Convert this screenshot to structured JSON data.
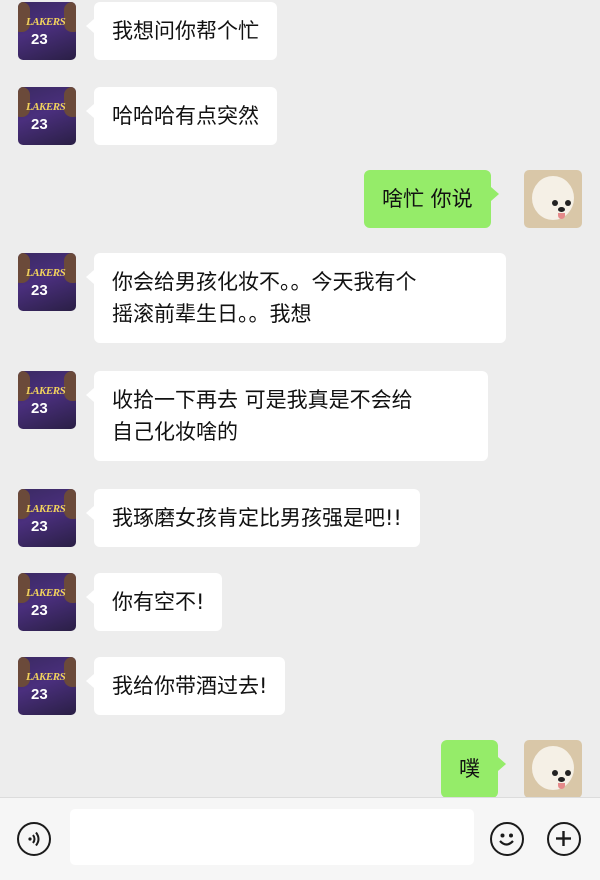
{
  "messages": [
    {
      "side": "left",
      "avatar": "lakers-23-avatar",
      "lines": [
        "我想问你帮个忙"
      ]
    },
    {
      "side": "left",
      "avatar": "lakers-23-avatar",
      "lines": [
        "哈哈哈有点突然"
      ]
    },
    {
      "side": "right",
      "avatar": "white-dog-avatar",
      "lines": [
        "啥忙 你说"
      ]
    },
    {
      "side": "left",
      "avatar": "lakers-23-avatar",
      "lines": [
        "你会给男孩化妆不。。今天我有个",
        "摇滚前辈生日。。我想"
      ]
    },
    {
      "side": "left",
      "avatar": "lakers-23-avatar",
      "lines": [
        "收拾一下再去 可是我真是不会给",
        "自己化妆啥的"
      ]
    },
    {
      "side": "left",
      "avatar": "lakers-23-avatar",
      "lines": [
        "我琢磨女孩肯定比男孩强是吧!!"
      ]
    },
    {
      "side": "left",
      "avatar": "lakers-23-avatar",
      "lines": [
        "你有空不!"
      ]
    },
    {
      "side": "left",
      "avatar": "lakers-23-avatar",
      "lines": [
        "我给你带酒过去!"
      ]
    },
    {
      "side": "right",
      "avatar": "white-dog-avatar",
      "lines": [
        "噗"
      ]
    }
  ],
  "avatar_text": {
    "team": "LAKERS",
    "number": "23"
  },
  "input_bar": {
    "icons": [
      "voice-icon",
      "emoji-icon",
      "plus-icon"
    ],
    "text_value": ""
  },
  "colors": {
    "background": "#ededed",
    "incoming_bubble": "#ffffff",
    "outgoing_bubble": "#95ec69",
    "input_bar": "#f6f6f6"
  }
}
